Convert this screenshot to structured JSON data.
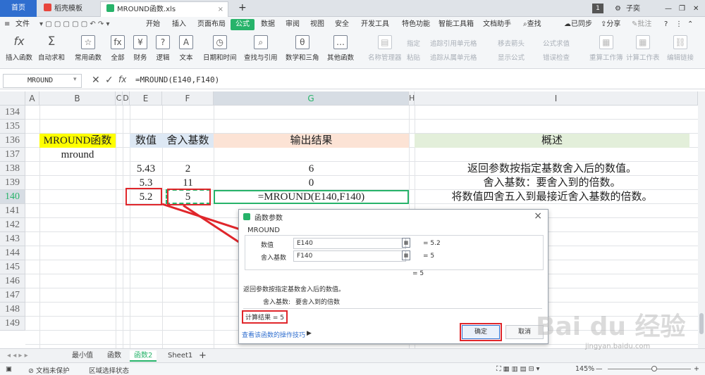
{
  "tabs": {
    "home": "首页",
    "template": "稻壳模板",
    "file": "MROUND函数.xls",
    "new": "+",
    "user": "子奕"
  },
  "menu": {
    "file": "文件",
    "items": [
      "开始",
      "插入",
      "页面布局",
      "公式",
      "数据",
      "审阅",
      "视图",
      "安全",
      "开发工具",
      "特色功能",
      "智能工具箱",
      "文档助手"
    ],
    "search": "查找",
    "sync": "已同步",
    "share": "分享",
    "annotate": "批注"
  },
  "ribbon": {
    "insert_function": "插入函数",
    "autosum": "自动求和",
    "common": "常用函数",
    "all": "全部",
    "finance": "财务",
    "logic": "逻辑",
    "text": "文本",
    "datetime": "日期和时间",
    "lookup": "查找与引用",
    "math": "数学和三角",
    "other": "其他函数",
    "name_mgr": "名称管理器",
    "specify": "指定",
    "paste": "粘贴",
    "trace_prec": "追踪引用单元格",
    "trace_dep": "追踪从属单元格",
    "remove_arrows": "移去箭头",
    "show_formula": "显示公式",
    "formula_eval": "公式求值",
    "error_check": "错误检查",
    "recalc": "重算工作簿",
    "calc_sheet": "计算工作表",
    "edit_links": "编辑链接"
  },
  "formula_bar": {
    "name_box": "MROUND",
    "fx": "fx",
    "formula": "=MROUND(E140,F140)"
  },
  "columns": [
    "A",
    "B",
    "C",
    "D",
    "E",
    "F",
    "G",
    "H",
    "I"
  ],
  "rows": [
    "134",
    "135",
    "136",
    "137",
    "138",
    "139",
    "140",
    "141",
    "142",
    "143",
    "144",
    "145",
    "146",
    "147",
    "148",
    "149"
  ],
  "cells": {
    "b136": "MROUND函数",
    "b137": "mround",
    "e136": "数值",
    "f136": "舍入基数",
    "g136": "输出结果",
    "i136": "概述",
    "e138": "5.43",
    "f138": "2",
    "g138": "6",
    "e139": "5.3",
    "f139": "11",
    "g139": "0",
    "e140": "5.2",
    "f140": "5",
    "g140": "=MROUND(E140,F140)",
    "i138": "返回参数按指定基数舍入后的数值。",
    "i139": "舍入基数：要舍入到的倍数。",
    "i140": "将数值四舍五入到最接近舍入基数的倍数。"
  },
  "dialog": {
    "title": "函数参数",
    "func": "MROUND",
    "arg1_label": "数值",
    "arg1_value": "E140",
    "arg1_result": "= 5.2",
    "arg2_label": "舍入基数",
    "arg2_value": "F140",
    "arg2_result": "= 5",
    "total": "= 5",
    "desc": "返回参数按指定基数舍入后的数值。",
    "arg_desc_label": "舍入基数:",
    "arg_desc": "要舍入到的倍数",
    "calc_result": "计算结果 = 5",
    "help_link": "查看该函数的操作技巧",
    "ok": "确定",
    "cancel": "取消",
    "close": "×"
  },
  "sheet_tabs": [
    "最小值",
    "函数",
    "函数2",
    "Sheet1"
  ],
  "status": {
    "protect": "文档未保护",
    "region": "区域选择状态",
    "zoom": "145%"
  },
  "watermark": {
    "brand": "Bai du 经验",
    "url": "jingyan.baidu.com"
  },
  "colors": {
    "accent": "#27b36a",
    "home_tab": "#2f6ecf",
    "header_yellow": "#ffff00",
    "header_blue": "#dde8f4",
    "header_peach": "#fce3d5",
    "header_green": "#e3efda",
    "annotation_red": "#e0262b"
  }
}
